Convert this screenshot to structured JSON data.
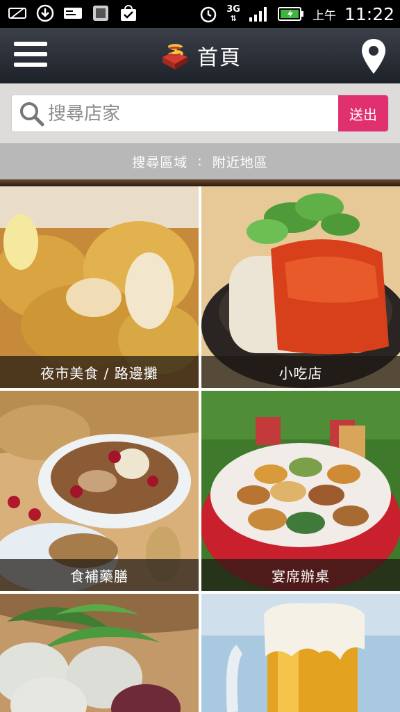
{
  "status_bar": {
    "network": "3G",
    "ampm": "上午",
    "time": "11:22"
  },
  "header": {
    "title": "首頁",
    "menu_icon": "hamburger-menu-icon",
    "location_icon": "map-pin-icon"
  },
  "search": {
    "placeholder": "搜尋店家",
    "value": "",
    "submit_label": "送出"
  },
  "region": {
    "label": "搜尋區域",
    "separator": ":",
    "value": "附近地區"
  },
  "categories": [
    {
      "label": "夜市美食 / 路邊攤"
    },
    {
      "label": "小吃店"
    },
    {
      "label": "食補藥膳"
    },
    {
      "label": "宴席辦桌"
    },
    {
      "label": ""
    },
    {
      "label": ""
    }
  ],
  "colors": {
    "accent": "#e0306f",
    "header": "#2a2e35"
  }
}
